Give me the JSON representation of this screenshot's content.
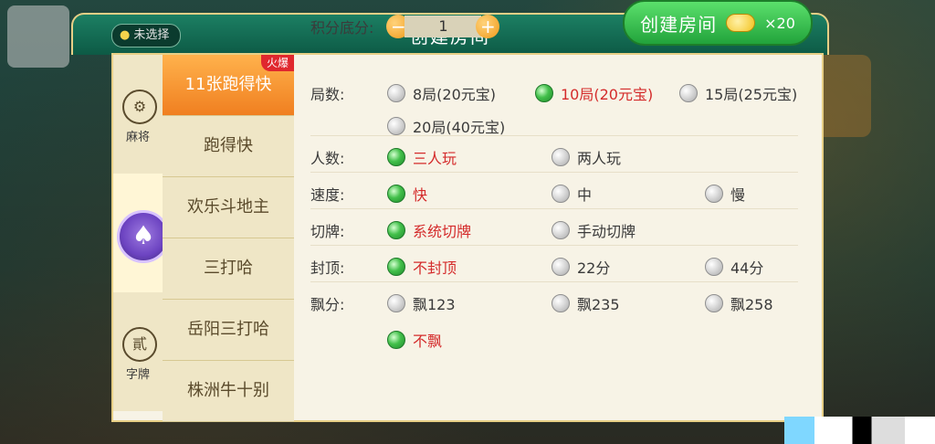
{
  "dialog": {
    "title": "创建房间",
    "close_symbol": "✕",
    "location": {
      "icon": "map-pin-icon",
      "text": "未选择"
    }
  },
  "categories": [
    {
      "label": "麻将",
      "icon": "mahjong-tile-icon"
    },
    {
      "label": "",
      "icon": "poker-spade-icon"
    },
    {
      "label": "字牌",
      "icon": "zipai-icon",
      "symbol": "貳"
    }
  ],
  "games": [
    {
      "label": "11张跑得快",
      "badge": "火爆",
      "active": true
    },
    {
      "label": "跑得快"
    },
    {
      "label": "欢乐斗地主"
    },
    {
      "label": "三打哈"
    },
    {
      "label": "岳阳三打哈"
    },
    {
      "label": "株洲牛十别"
    }
  ],
  "options": {
    "rounds": {
      "label": "局数:",
      "choices": [
        "8局(20元宝)",
        "10局(20元宝)",
        "15局(25元宝)",
        "20局(40元宝)"
      ],
      "selected": 1
    },
    "players": {
      "label": "人数:",
      "choices": [
        "三人玩",
        "两人玩"
      ],
      "selected": 0
    },
    "speed": {
      "label": "速度:",
      "choices": [
        "快",
        "中",
        "慢"
      ],
      "selected": 0
    },
    "cut": {
      "label": "切牌:",
      "choices": [
        "系统切牌",
        "手动切牌"
      ],
      "selected": 0
    },
    "cap": {
      "label": "封顶:",
      "choices": [
        "不封顶",
        "22分",
        "44分"
      ],
      "selected": 0
    },
    "float": {
      "label": "飘分:",
      "choices": [
        "飘123",
        "飘235",
        "飘258",
        "不飘"
      ],
      "selected": 3
    }
  },
  "score": {
    "label": "积分底分:",
    "value": "1",
    "minus": "−",
    "plus": "+"
  },
  "create_button": {
    "label": "创建房间",
    "cost": "×20",
    "icon": "gold-ingot-icon"
  }
}
